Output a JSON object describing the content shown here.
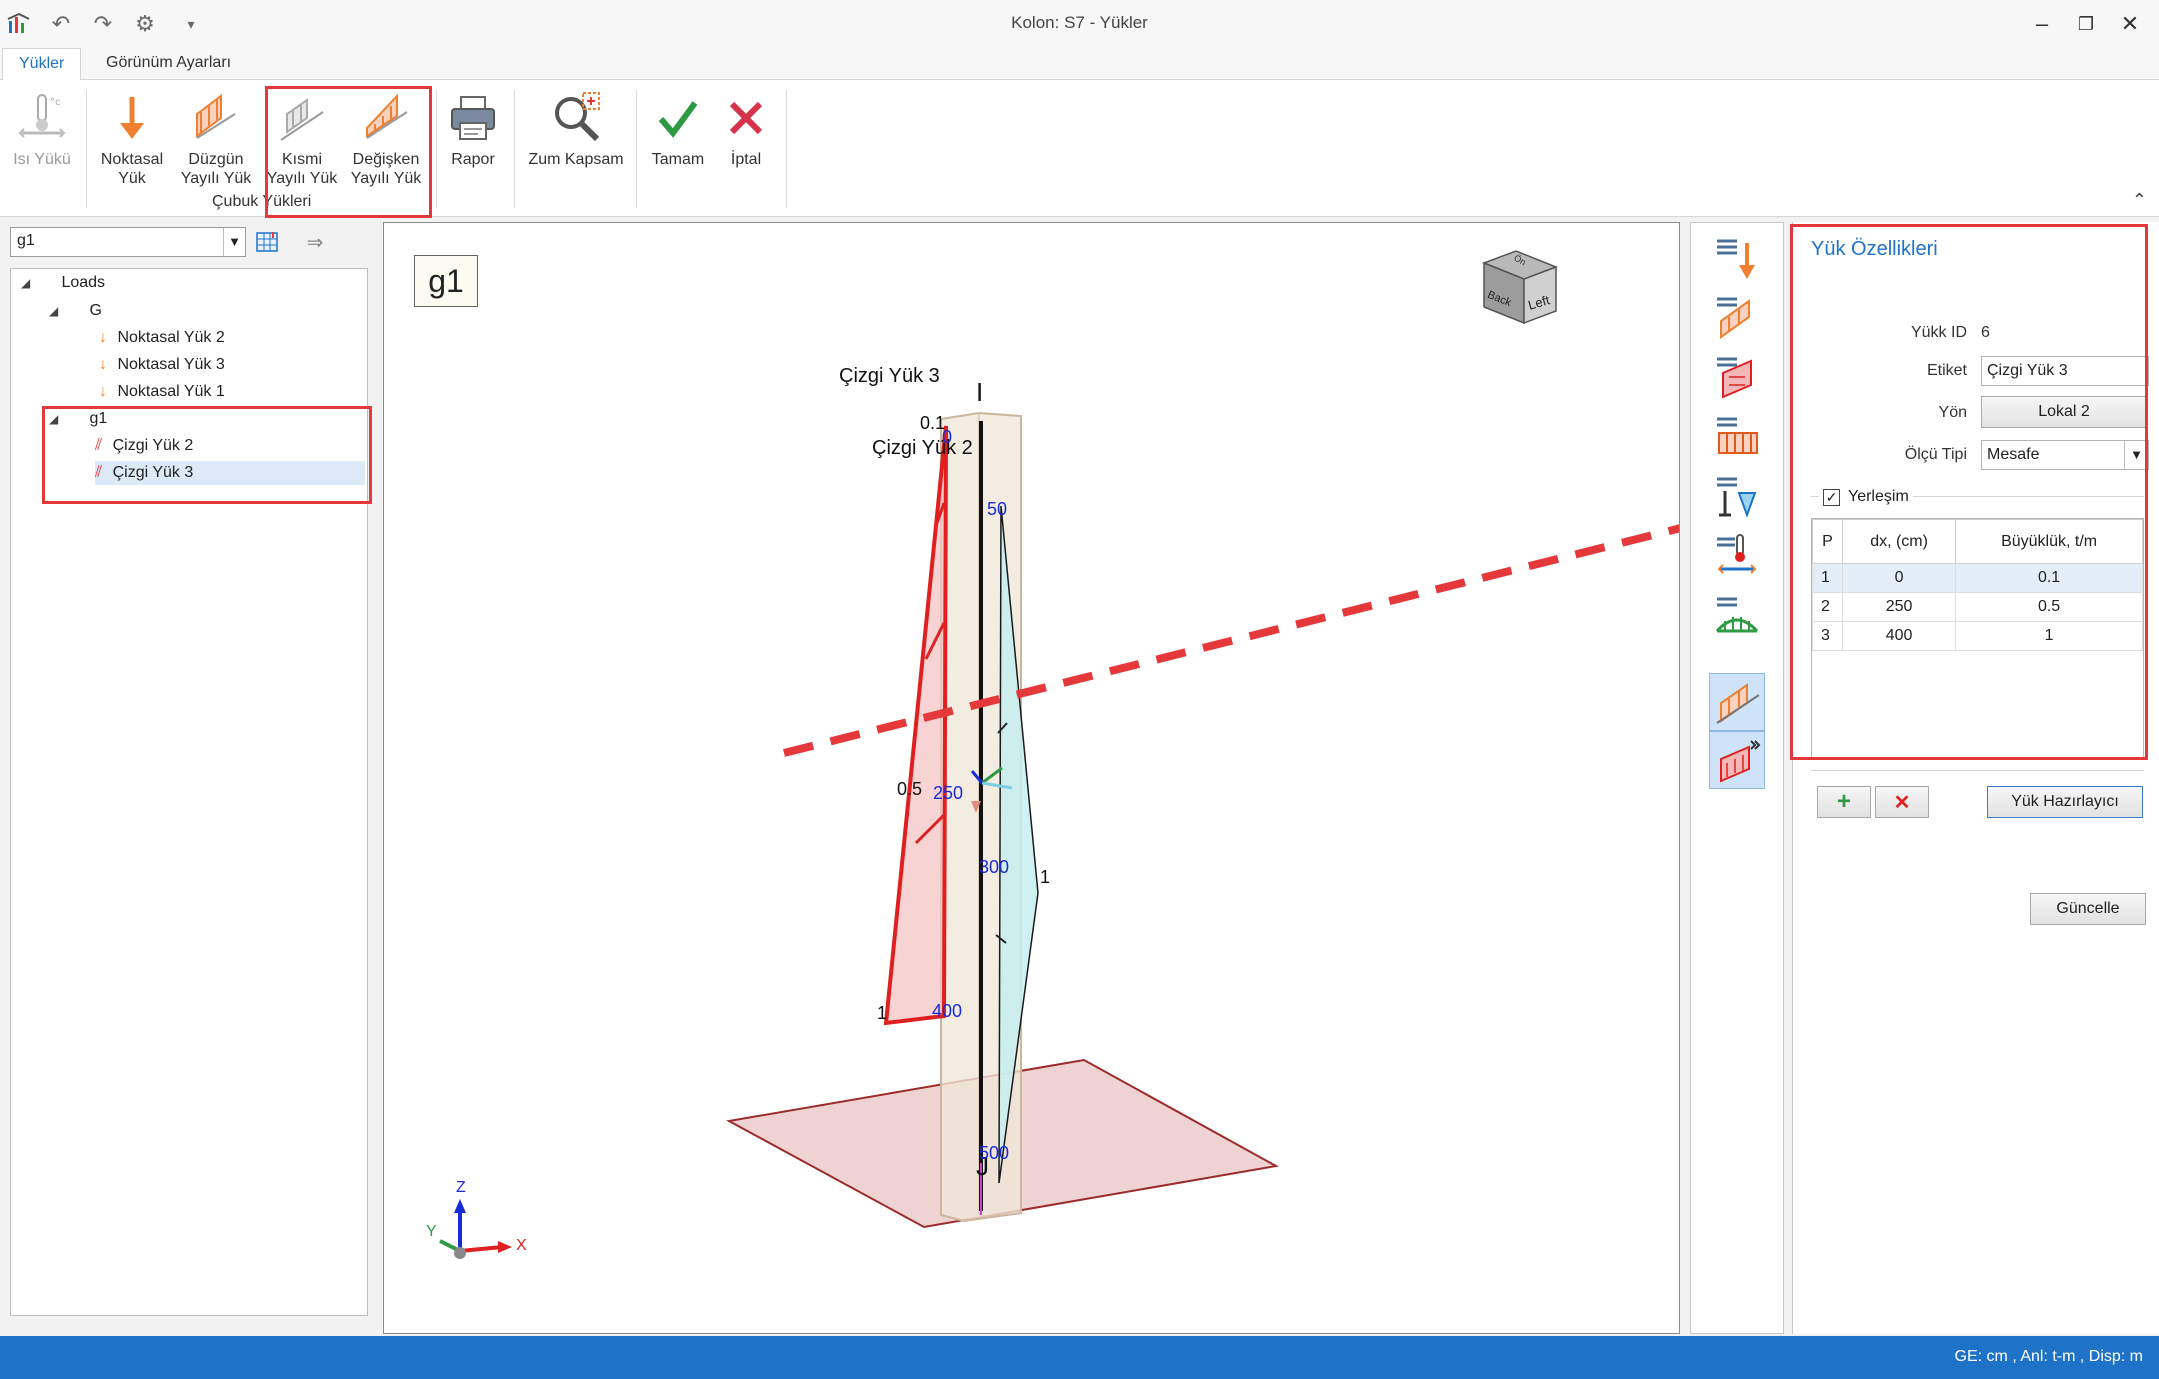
{
  "window": {
    "title": "Kolon: S7 - Yükler"
  },
  "quick_access": [
    "app-logo-icon",
    "undo-icon",
    "redo-icon",
    "settings-icon",
    "customize-icon"
  ],
  "tabs": [
    {
      "label": "Yükler",
      "active": true
    },
    {
      "label": "Görünüm Ayarları",
      "active": false
    }
  ],
  "ribbon": {
    "isi": "Isı Yükü",
    "noktasal": [
      "Noktasal",
      "Yük"
    ],
    "duzgun": [
      "Düzgün",
      "Yayılı Yük"
    ],
    "kismi": [
      "Kısmi",
      "Yayılı Yük"
    ],
    "degisken": [
      "Değişken",
      "Yayılı Yük"
    ],
    "rapor": "Rapor",
    "zum": "Zum Kapsam",
    "tamam": "Tamam",
    "iptal": "İptal",
    "group_label": "Çubuk Yükleri"
  },
  "left": {
    "combo_value": "g1",
    "tree": {
      "root": "Loads",
      "g": "G",
      "g_items": [
        "Noktasal Yük 2",
        "Noktasal Yük 3",
        "Noktasal Yük 1"
      ],
      "g1": "g1",
      "g1_items": [
        "Çizgi Yük 2",
        "Çizgi Yük 3"
      ]
    }
  },
  "viewport": {
    "badge": "g1",
    "load_labels": {
      "cizgi3": "Çizgi Yük 3",
      "cizgi2": "Çizgi Yük 2"
    },
    "node_labels": {
      "top": "I",
      "bottom": "J"
    },
    "values_red": [
      "0.1",
      "0.5",
      "1"
    ],
    "values_blue": [
      "0",
      "50",
      "250",
      "300",
      "400",
      "500"
    ],
    "values_black": [
      "1"
    ],
    "cube": {
      "back": "Back",
      "left": "Left",
      "top": "Ön"
    },
    "axes": {
      "x": "X",
      "y": "Y",
      "z": "Z"
    }
  },
  "props": {
    "title": "Yük Özellikleri",
    "id_label": "Yükk ID",
    "id_value": "6",
    "etiket_label": "Etiket",
    "etiket_value": "Çizgi Yük 3",
    "yon_label": "Yön",
    "yon_value": "Lokal 2",
    "olcu_label": "Ölçü Tipi",
    "olcu_value": "Mesafe",
    "yerlesim_label": "Yerleşim",
    "grid_headers": [
      "P",
      "dx, (cm)",
      "Büyüklük, t/m"
    ],
    "grid_rows": [
      [
        "1",
        "0",
        "0.1"
      ],
      [
        "2",
        "250",
        "0.5"
      ],
      [
        "3",
        "400",
        "1"
      ]
    ],
    "hazirlayici": "Yük Hazırlayıcı",
    "guncelle": "Güncelle"
  },
  "status": {
    "text": "GE: cm , Anl: t-m , Disp: m"
  },
  "colors": {
    "accent": "#1e73c8",
    "highlight": "#e5383b",
    "status": "#1e73c8"
  }
}
